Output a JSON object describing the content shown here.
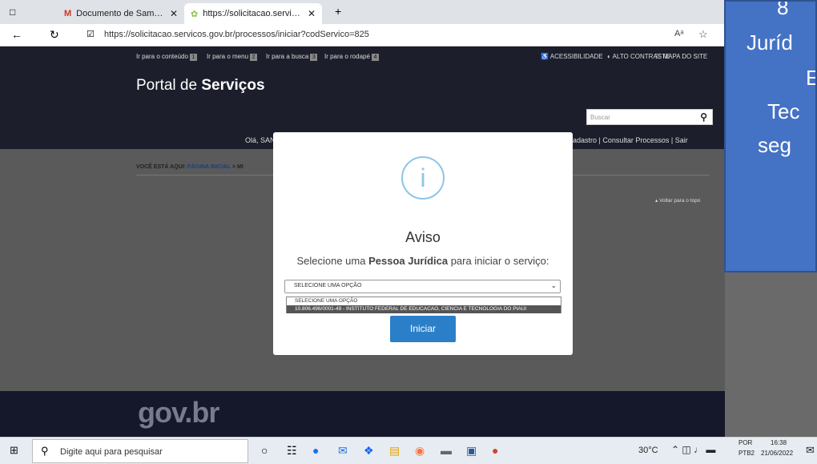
{
  "browser": {
    "tabs": [
      {
        "label": "Documento de Samara Pereira -",
        "active": false
      },
      {
        "label": "https://solicitacao.servicos.gov.b",
        "active": true
      }
    ],
    "new_tab": "+",
    "url": "https://solicitacao.servicos.gov.br/processos/iniciar?codServico=825",
    "read_aloud": "Aᵃ"
  },
  "site": {
    "skip_links": [
      {
        "label": "Ir para o conteúdo",
        "num": "1"
      },
      {
        "label": "Ir para o menu",
        "num": "2"
      },
      {
        "label": "Ir para a busca",
        "num": "3"
      },
      {
        "label": "Ir para o rodapé",
        "num": "4"
      }
    ],
    "accessibility": "ACESSIBILIDADE",
    "contrast": "ALTO CONTRASTE",
    "sitemap": "MAPA DO SITE",
    "portal_prefix": "Portal de",
    "portal_bold": "Serviços",
    "search_placeholder": "Buscar",
    "greeting": "Olá, SAN",
    "user_links": "adastro | Consultar Processos | Sair",
    "breadcrumb_label": "VOCÊ ESTÁ AQUI:",
    "breadcrumb_home": "PÁGINA INICIAL",
    "breadcrumb_sep": ">",
    "breadcrumb_next": "MI",
    "back_to_top": "▴ Voltar para o topo",
    "footer_logo": "gov.br"
  },
  "slide": {
    "lines": [
      "8",
      "Juríd",
      "E",
      "Tec",
      "seg"
    ]
  },
  "modal": {
    "icon": "i",
    "title": "Aviso",
    "message_pre": "Selecione uma ",
    "message_bold": "Pessoa Jurídica",
    "message_post": " para iniciar o serviço:",
    "select_value": "SELECIONE UMA OPÇÃO",
    "options": [
      "SELECIONE UMA OPÇÃO",
      "10.806.496/0001-49 - INSTITUTO FEDERAL DE EDUCACAO, CIENCIA E TECNOLOGIA DO PIAUI"
    ],
    "button": "Iniciar"
  },
  "taskbar": {
    "search_placeholder": "Digite aqui para pesquisar",
    "temperature": "30°C",
    "language_top": "POR",
    "language_bottom": "PTB2",
    "time": "16:38",
    "date": "21/06/2022"
  }
}
